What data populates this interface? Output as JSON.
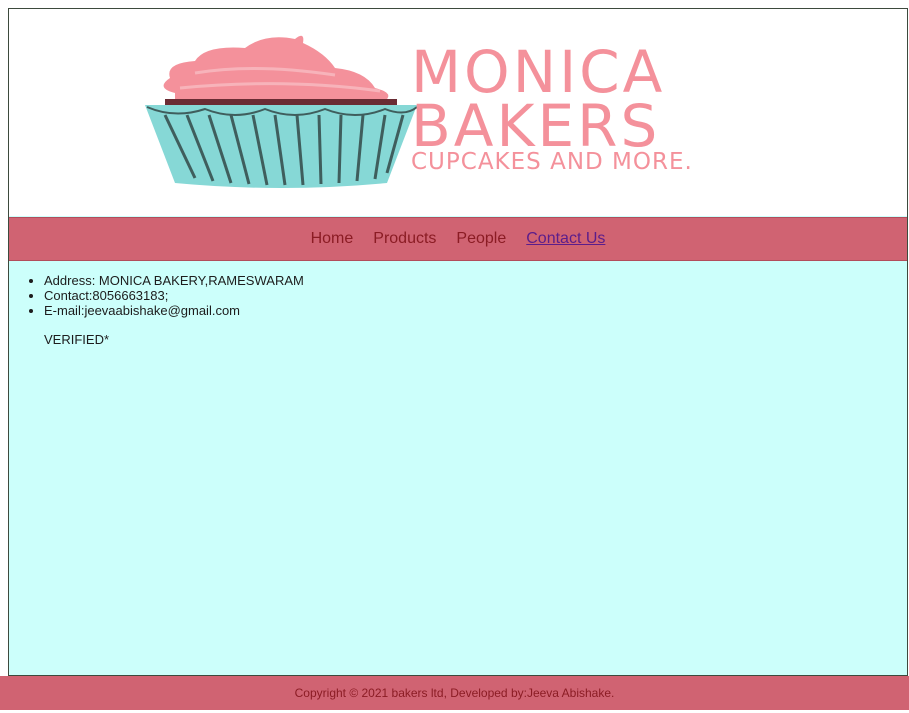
{
  "logo": {
    "line1": "MONICA",
    "line2": "BAKERS",
    "line3": "CUPCAKES AND MORE."
  },
  "nav": {
    "items": [
      "Home",
      "Products",
      "People",
      "Contact Us"
    ],
    "active": "Contact Us"
  },
  "contact": {
    "items": [
      "Address: MONICA BAKERY,RAMESWARAM",
      "Contact:8056663183;",
      "E-mail:jeevaabishake@gmail.com"
    ],
    "verified": "VERIFIED*"
  },
  "footer": {
    "text": "Copyright © 2021 bakers ltd, Developed by:Jeeva Abishake."
  },
  "colors": {
    "nav_bg": "#d06372",
    "content_bg": "#ccfffb",
    "logo_pink": "#f4919b",
    "cupcake_liner": "#86d8d6"
  }
}
